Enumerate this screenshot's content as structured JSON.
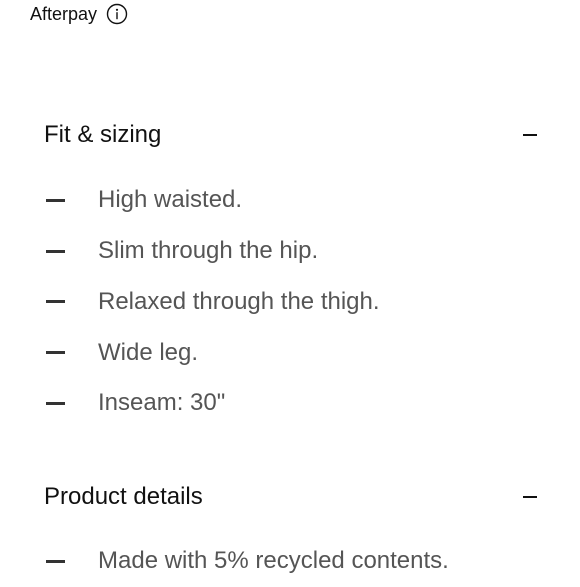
{
  "afterpay": {
    "label": "Afterpay",
    "info_icon": "info-circle-icon"
  },
  "sections": [
    {
      "title": "Fit & sizing",
      "toggle_icon": "minus-icon",
      "items": [
        "High waisted.",
        "Slim through the hip.",
        "Relaxed through the thigh.",
        "Wide leg.",
        "Inseam: 30\""
      ]
    },
    {
      "title": "Product details",
      "toggle_icon": "minus-icon",
      "items": [
        "Made with 5% recycled contents."
      ]
    }
  ]
}
